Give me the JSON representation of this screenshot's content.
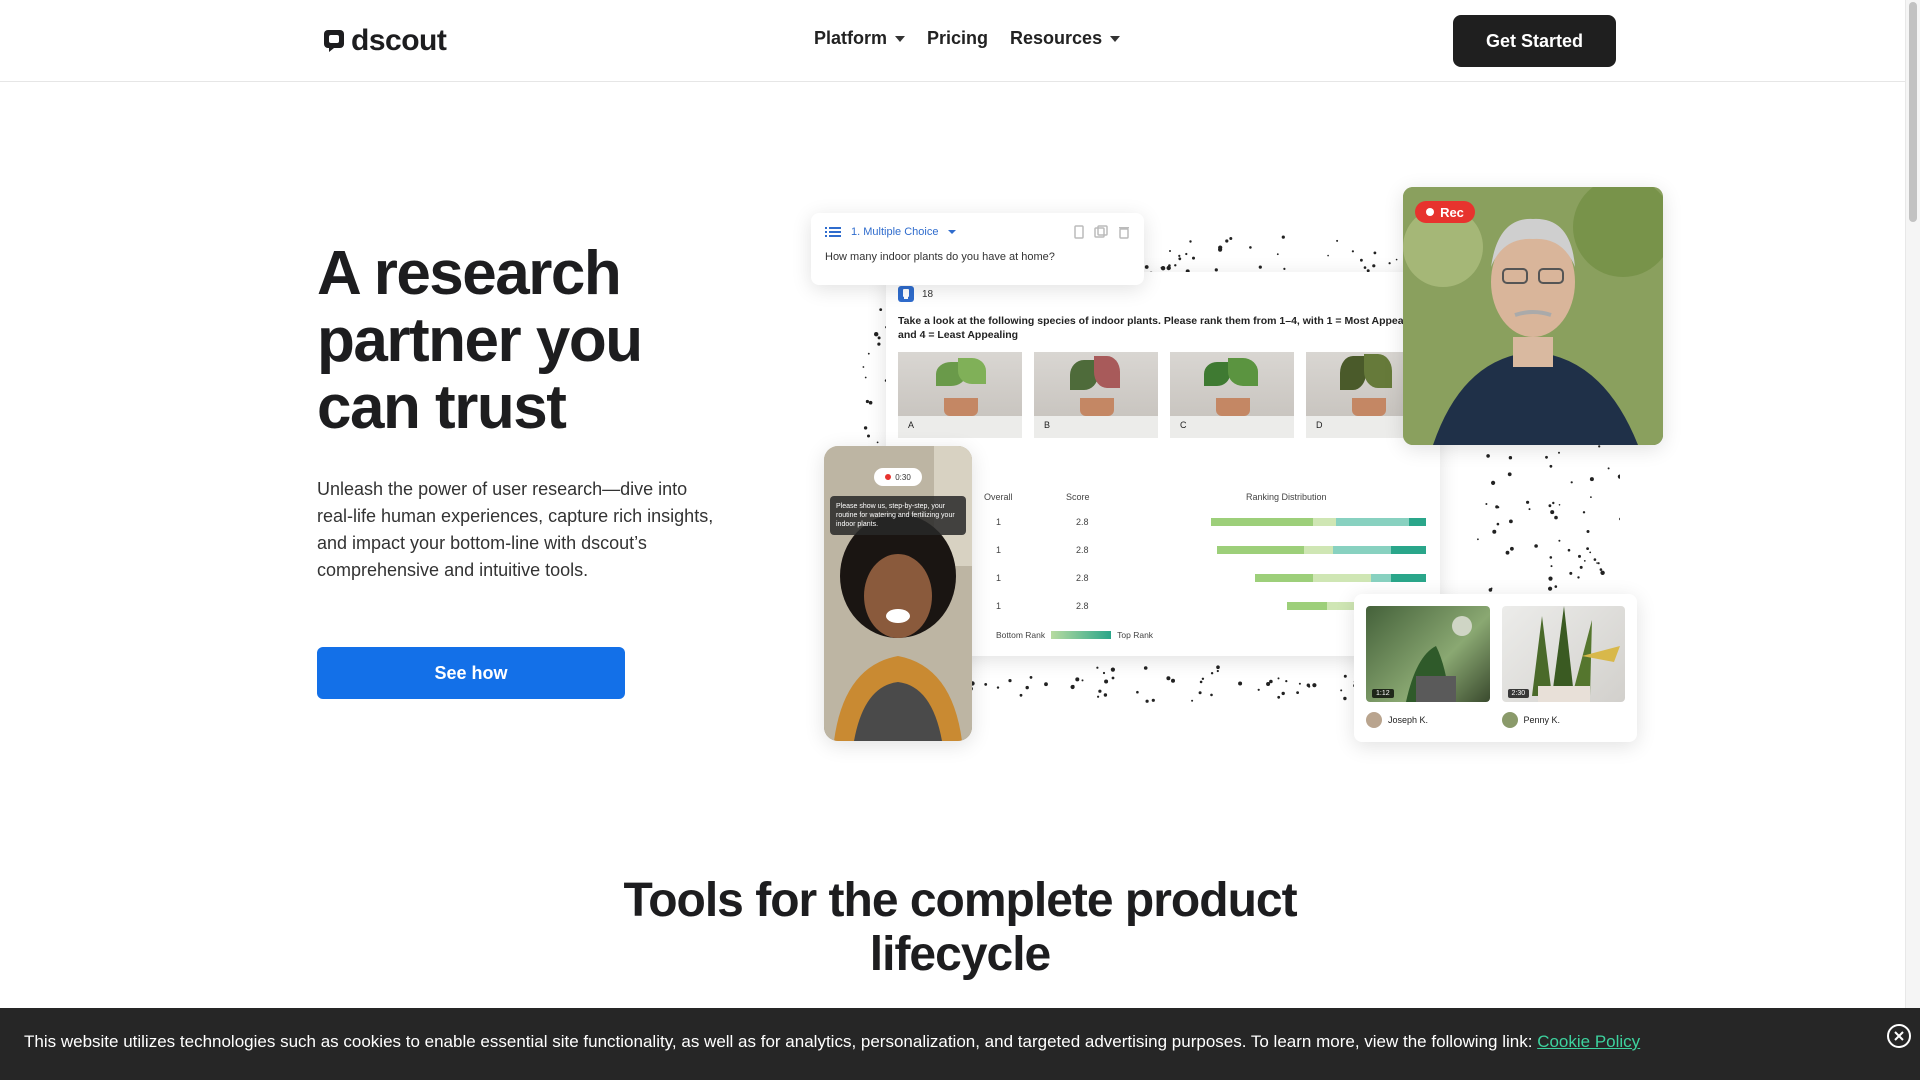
{
  "brand": {
    "name": "dscout"
  },
  "nav": {
    "items": [
      {
        "label": "Platform",
        "has_dropdown": true
      },
      {
        "label": "Pricing",
        "has_dropdown": false
      },
      {
        "label": "Resources",
        "has_dropdown": true
      }
    ],
    "cta_label": "Get Started"
  },
  "hero": {
    "title": "A research partner you can trust",
    "subtitle": "Unleash the power of user research—dive into real-life human experiences, capture rich insights, and impact your bottom-line with dscout’s comprehensive and intuitive tools.",
    "cta_label": "See how"
  },
  "collage": {
    "multiple_choice": {
      "type_label": "1. Multiple Choice",
      "question": "How many indoor plants do you have at home?"
    },
    "ranking": {
      "count": "18",
      "question": "Take a look at the following species of indoor plants. Please rank them from 1–4, with 1 = Most Appealing and 4 = Least Appealing",
      "options": [
        "A",
        "B",
        "C",
        "D"
      ],
      "columns": {
        "overall": "Overall",
        "score": "Score",
        "distribution": "Ranking Distribution"
      },
      "rows": [
        {
          "overall": "1",
          "score": "2.8",
          "dist": [
            0.35,
            0.08,
            0.25,
            0.06
          ]
        },
        {
          "overall": "1",
          "score": "2.8",
          "dist": [
            0.3,
            0.1,
            0.2,
            0.12
          ]
        },
        {
          "overall": "1",
          "score": "2.8",
          "dist": [
            0.2,
            0.2,
            0.07,
            0.12
          ]
        },
        {
          "overall": "1",
          "score": "2.8",
          "dist": [
            0.14,
            0.14,
            0.1,
            0.1
          ]
        }
      ],
      "legend": {
        "bottom": "Bottom Rank",
        "top": "Top Rank"
      }
    },
    "video": {
      "rec_label": "Rec"
    },
    "phone": {
      "timer": "0:30",
      "prompt": "Please show us, step-by-step, your routine for watering and fertilizing your indoor plants."
    },
    "clips": [
      {
        "time": "1:12",
        "name": "Joseph K."
      },
      {
        "time": "2:30",
        "name": "Penny K."
      }
    ],
    "colors": {
      "light_green": "#9dcf7a",
      "pale_green": "#cfe6b4",
      "teal_light": "#88d1c0",
      "teal": "#2aa68a"
    }
  },
  "section": {
    "title": "Tools for the complete product lifecycle"
  },
  "cookie": {
    "text": "This website utilizes technologies such as cookies to enable essential site functionality, as well as for analytics, personalization, and targeted advertising purposes. To learn more, view the following link:",
    "link_label": "Cookie Policy",
    "close_icon": "close-circle-icon"
  }
}
